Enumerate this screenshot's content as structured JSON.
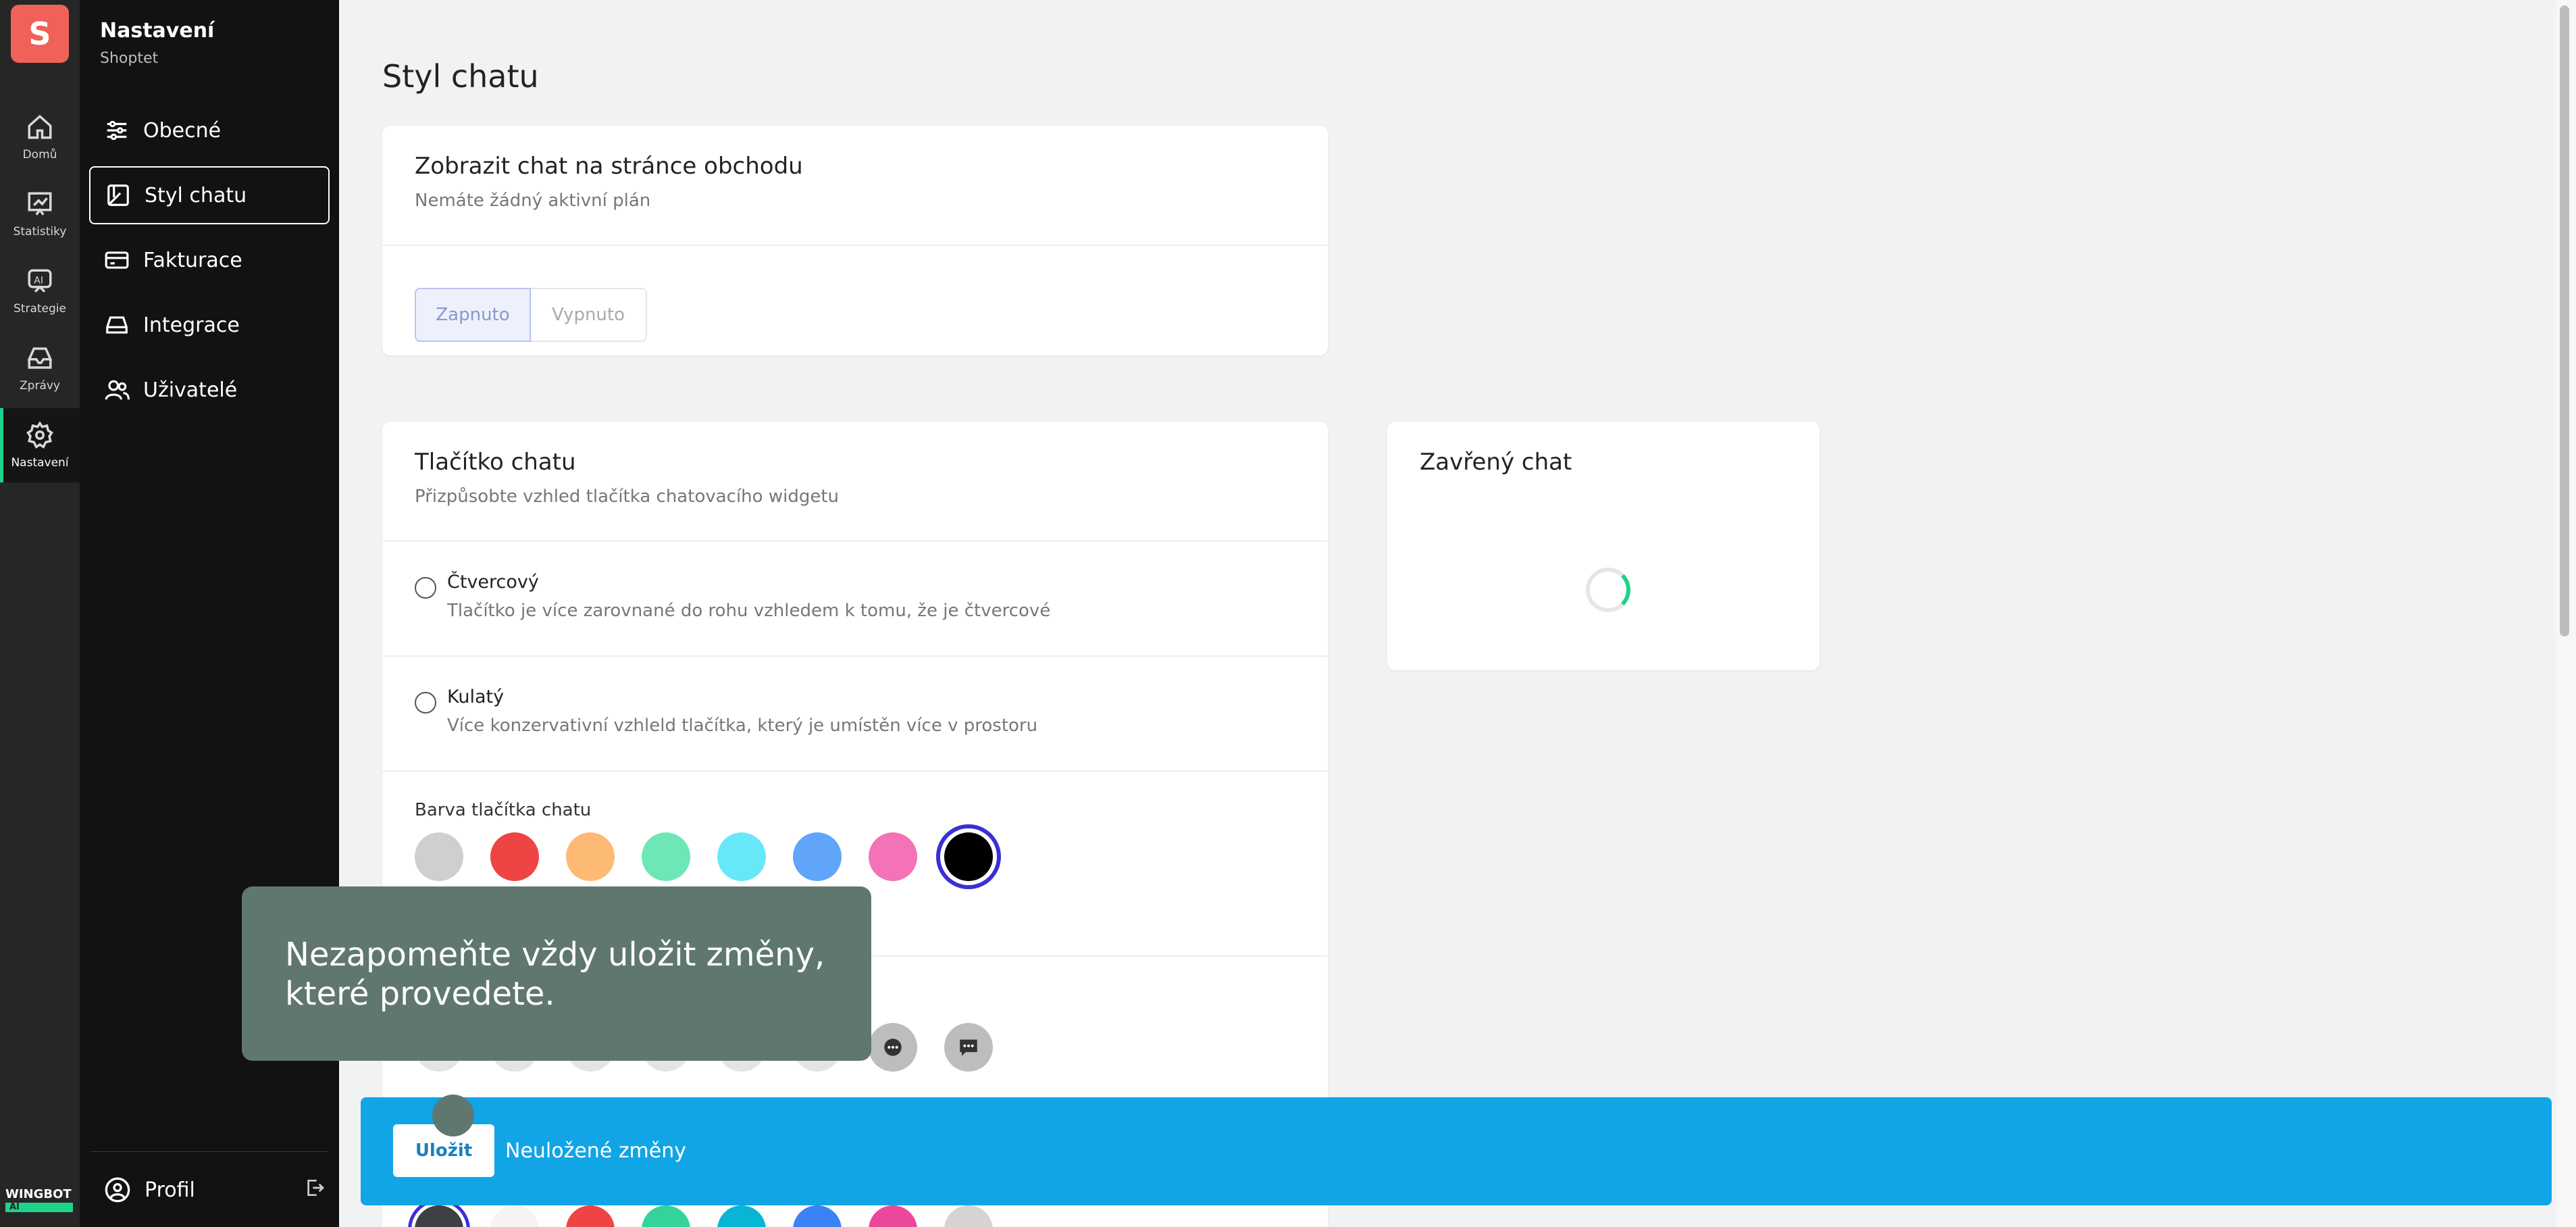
{
  "app": {
    "logo_letter": "S",
    "brand_text": "WINGBOT",
    "brand_sub": "AI"
  },
  "rail": [
    {
      "label": "Domů",
      "icon": "home-icon"
    },
    {
      "label": "Statistiky",
      "icon": "chart-icon"
    },
    {
      "label": "Strategie",
      "icon": "ai-icon"
    },
    {
      "label": "Zprávy",
      "icon": "inbox-icon"
    },
    {
      "label": "Nastavení",
      "icon": "gear-icon",
      "active": true
    }
  ],
  "sidebar": {
    "title": "Nastavení",
    "subtitle": "Shoptet",
    "items": [
      {
        "label": "Obecné",
        "icon": "sliders-icon"
      },
      {
        "label": "Styl chatu",
        "icon": "palette-icon",
        "active": true
      },
      {
        "label": "Fakturace",
        "icon": "card-icon"
      },
      {
        "label": "Integrace",
        "icon": "drive-icon"
      },
      {
        "label": "Uživatelé",
        "icon": "users-icon"
      }
    ],
    "profile_label": "Profil"
  },
  "main": {
    "title": "Styl chatu",
    "show_chat": {
      "title": "Zobrazit chat na stránce obchodu",
      "subtitle": "Nemáte žádný aktivní plán",
      "on_label": "Zapnuto",
      "off_label": "Vypnuto"
    },
    "chat_button": {
      "title": "Tlačítko chatu",
      "subtitle": "Přizpůsobte vzhled tlačítka chatovacího widgetu",
      "options": [
        {
          "title": "Čtvercový",
          "desc": "Tlačítko je více zarovnané do rohu vzhledem k tomu, že je čtvercové"
        },
        {
          "title": "Kulatý",
          "desc": "Více konzervativní vzhleld tlačítka, který je umístěn více v prostoru"
        }
      ],
      "color_label": "Barva tlačítka chatu",
      "colors": [
        "#cfcfcf",
        "#ef4444",
        "#fdba74",
        "#6ee7b7",
        "#67e8f9",
        "#60a5fa",
        "#f472b6",
        "#000000"
      ],
      "selected_color": "#000000",
      "bottom_colors": [
        "#3f3f46",
        "#f4f4f5",
        "#ef4444",
        "#34d399",
        "#06b6d4",
        "#3b82f6",
        "#ec4899",
        "#d4d4d4"
      ]
    },
    "closed_chat": {
      "title": "Zavřený chat"
    }
  },
  "tooltip": {
    "text": "Nezapomeňte vždy uložit změny, které provedete."
  },
  "save_bar": {
    "button_label": "Uložit",
    "status": "Neuložené změny",
    "color": "#11a5e6"
  }
}
